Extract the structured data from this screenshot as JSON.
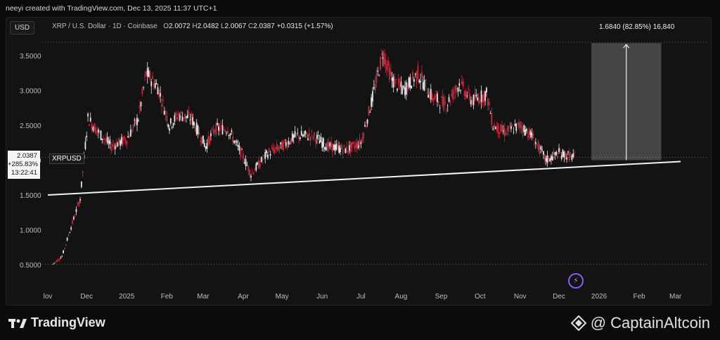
{
  "header": {
    "attribution": "neeyi created with TradingView.com, Dec 13, 2025 11:37 UTC+1"
  },
  "toolbar": {
    "currency": "USD"
  },
  "legend": {
    "symbol": "XRP / U.S. Dollar · 1D · Coinbase",
    "o_label": "O",
    "o": "2.0072",
    "h_label": "H",
    "h": "2.0482",
    "l_label": "L",
    "l": "2.0067",
    "c_label": "C",
    "c": "2.0387",
    "change": "+0.0315 (+1.57%)"
  },
  "price_tag": {
    "price": "2.0387",
    "change": "+285.83%",
    "countdown": "13:22:41"
  },
  "ticker_tag": "XRPUSD",
  "measure": {
    "label": "1.6840 (82.85%) 16,840"
  },
  "chart_data": {
    "type": "line",
    "x_ticks": [
      "lov",
      "Dec",
      "2025",
      "Feb",
      "Mar",
      "Apr",
      "May",
      "Jun",
      "Jul",
      "Aug",
      "Sep",
      "Oct",
      "Nov",
      "Dec",
      "2026",
      "Feb",
      "Mar"
    ],
    "y_ticks": [
      "3.5000",
      "3.0000",
      "2.5000",
      "2.0000",
      "1.5000",
      "1.0000",
      "0.5000"
    ],
    "ylim": [
      0.5,
      3.7
    ],
    "series": [
      {
        "x": [
          "2024-11-05",
          "2024-11-12",
          "2024-11-20",
          "2024-11-26",
          "2024-12-02",
          "2024-12-10",
          "2024-12-20",
          "2025-01-01",
          "2025-01-10",
          "2025-01-16",
          "2025-01-25",
          "2025-02-03",
          "2025-02-10",
          "2025-02-20",
          "2025-03-03",
          "2025-03-10",
          "2025-03-20",
          "2025-04-01",
          "2025-04-07",
          "2025-04-20",
          "2025-05-01",
          "2025-05-12",
          "2025-05-25",
          "2025-06-05",
          "2025-06-20",
          "2025-07-01",
          "2025-07-10",
          "2025-07-18",
          "2025-07-25",
          "2025-08-03",
          "2025-08-14",
          "2025-08-25",
          "2025-09-05",
          "2025-09-15",
          "2025-09-25",
          "2025-10-06",
          "2025-10-11",
          "2025-10-20",
          "2025-11-01",
          "2025-11-10",
          "2025-11-21",
          "2025-12-01",
          "2025-12-13"
        ],
        "values": [
          0.51,
          0.62,
          1.1,
          1.45,
          2.6,
          2.4,
          2.2,
          2.3,
          2.6,
          3.25,
          3.05,
          2.5,
          2.65,
          2.6,
          2.2,
          2.45,
          2.45,
          2.05,
          1.8,
          2.1,
          2.2,
          2.35,
          2.35,
          2.2,
          2.15,
          2.25,
          2.9,
          3.55,
          3.15,
          3.0,
          3.25,
          2.9,
          2.8,
          3.1,
          2.85,
          2.95,
          2.5,
          2.4,
          2.5,
          2.35,
          2.0,
          2.1,
          2.04
        ]
      }
    ]
  }
}
